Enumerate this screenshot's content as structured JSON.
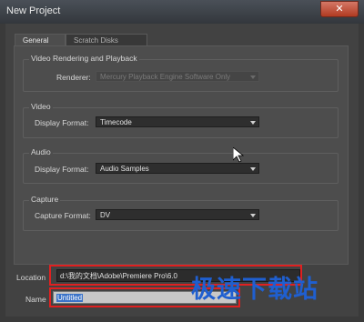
{
  "window": {
    "title": "New Project",
    "close_label": "✕"
  },
  "tabs": [
    {
      "label": "General",
      "active": true
    },
    {
      "label": "Scratch Disks",
      "active": false
    }
  ],
  "video_rendering": {
    "title": "Video Rendering and Playback",
    "renderer_label": "Renderer:",
    "renderer_value": "Mercury Playback Engine Software Only"
  },
  "video": {
    "title": "Video",
    "display_format_label": "Display Format:",
    "display_format_value": "Timecode"
  },
  "audio": {
    "title": "Audio",
    "display_format_label": "Display Format:",
    "display_format_value": "Audio Samples"
  },
  "capture": {
    "title": "Capture",
    "capture_format_label": "Capture Format:",
    "capture_format_value": "DV"
  },
  "location": {
    "label": "Location",
    "value": "d:\\我的文档\\Adobe\\Premiere Pro\\6.0"
  },
  "name": {
    "label": "Name",
    "value": "Untitled"
  },
  "watermark": {
    "text": "极速下载站"
  },
  "colors": {
    "highlight_box": "#e02020",
    "watermark": "#1f5fd0",
    "selection": "#3a72c8"
  }
}
